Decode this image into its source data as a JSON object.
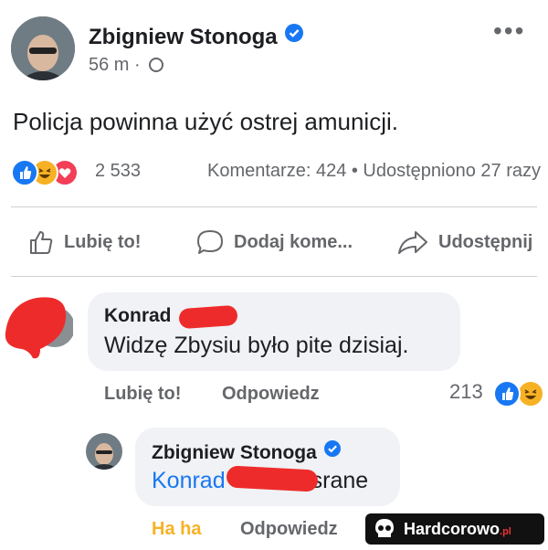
{
  "post": {
    "author": "Zbigniew Stonoga",
    "time": "56 m",
    "separator": "·",
    "text": "Policja powinna użyć ostrej amunicji.",
    "reactions_count": "2 533",
    "stats": "Komentarze: 424 • Udostępniono 27 razy",
    "more_label": "•••"
  },
  "actions": {
    "like": "Lubię to!",
    "comment": "Dodaj kome...",
    "share": "Udostępnij"
  },
  "comment1": {
    "author": "Konrad",
    "text": "Widzę Zbysiu było pite dzisiaj.",
    "like": "Lubię to!",
    "reply": "Odpowiedz",
    "reactions_count": "213"
  },
  "reply1": {
    "author": "Zbigniew Stonoga",
    "mention": "Konrad",
    "text_tail": "srane",
    "reaction_label": "Ha ha",
    "reply": "Odpowiedz"
  },
  "watermark": {
    "text": "Hardcorowo",
    "suffix": ".pl"
  },
  "colors": {
    "accent": "#1877f2",
    "haha": "#f7b125",
    "love": "#f33e58",
    "redaction": "#ee2b2b"
  }
}
